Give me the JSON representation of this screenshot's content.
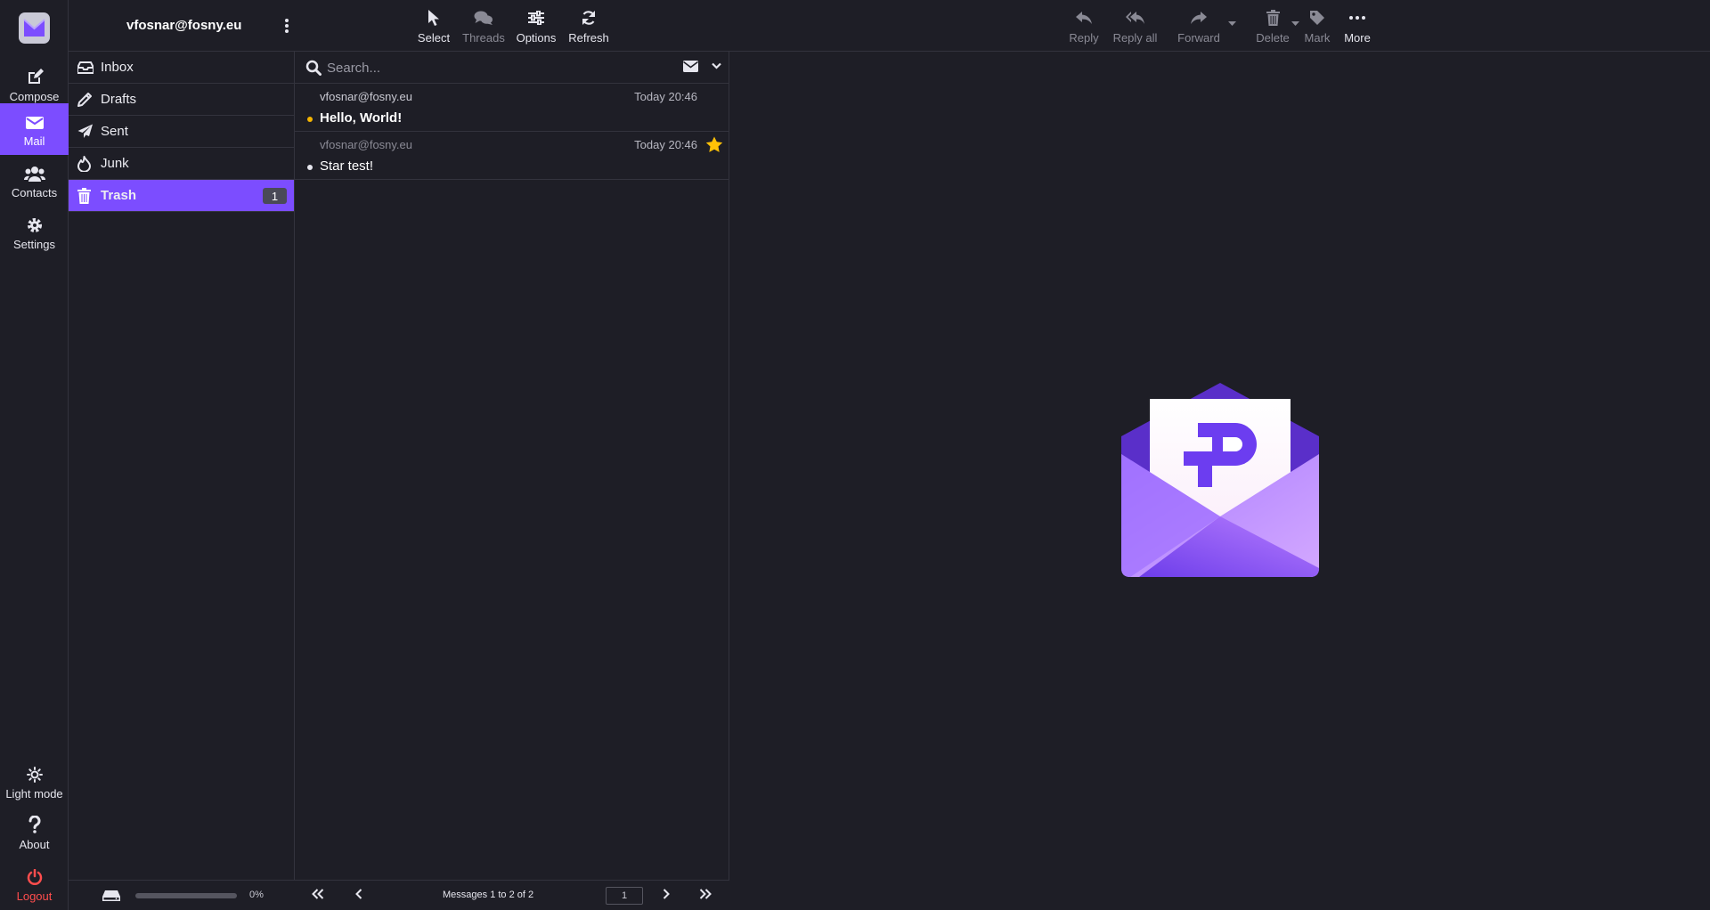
{
  "account": {
    "email": "vfosnar@fosny.eu"
  },
  "rail": {
    "items": [
      {
        "label": "Compose",
        "icon": "compose-icon"
      },
      {
        "label": "Mail",
        "icon": "mail-icon"
      },
      {
        "label": "Contacts",
        "icon": "contacts-icon"
      },
      {
        "label": "Settings",
        "icon": "gear-icon"
      }
    ],
    "bottom": [
      {
        "label": "Light mode",
        "icon": "sun-icon"
      },
      {
        "label": "About",
        "icon": "question-icon"
      },
      {
        "label": "Logout",
        "icon": "power-icon"
      }
    ]
  },
  "toolbar": {
    "left": [
      {
        "label": "Select",
        "icon": "pointer-icon"
      },
      {
        "label": "Threads",
        "icon": "comments-icon",
        "disabled": true
      },
      {
        "label": "Options",
        "icon": "sliders-icon"
      },
      {
        "label": "Refresh",
        "icon": "refresh-icon"
      }
    ],
    "right": [
      {
        "label": "Reply",
        "icon": "reply-icon",
        "disabled": true
      },
      {
        "label": "Reply all",
        "icon": "reply-all-icon",
        "disabled": true
      },
      {
        "label": "Forward",
        "icon": "forward-icon",
        "disabled": true
      },
      {
        "label": "Delete",
        "icon": "trash-icon",
        "disabled": true
      },
      {
        "label": "Mark",
        "icon": "tag-icon",
        "disabled": true
      },
      {
        "label": "More",
        "icon": "ellipsis-icon"
      }
    ]
  },
  "folders": [
    {
      "label": "Inbox",
      "icon": "inbox-icon"
    },
    {
      "label": "Drafts",
      "icon": "pencil-icon"
    },
    {
      "label": "Sent",
      "icon": "paper-plane-icon"
    },
    {
      "label": "Junk",
      "icon": "fire-icon"
    },
    {
      "label": "Trash",
      "icon": "trash-icon",
      "count": "1",
      "selected": true
    }
  ],
  "search": {
    "placeholder": "Search..."
  },
  "messages": [
    {
      "from": "vfosnar@fosny.eu",
      "date": "Today 20:46",
      "subject": "Hello, World!",
      "unread": true,
      "flagged": false
    },
    {
      "from": "vfosnar@fosny.eu",
      "date": "Today 20:46",
      "subject": "Star test!",
      "unread": false,
      "flagged": true
    }
  ],
  "status": {
    "quota_label": "0%",
    "quota_fraction": 0,
    "pager_label": "Messages 1 to 2 of 2",
    "page": "1"
  },
  "colors": {
    "background": "#1e1e26",
    "accent": "#7c4dff",
    "unread_dot": "#f5b400",
    "star": "#ffc107",
    "logout": "#ff4d4d"
  }
}
